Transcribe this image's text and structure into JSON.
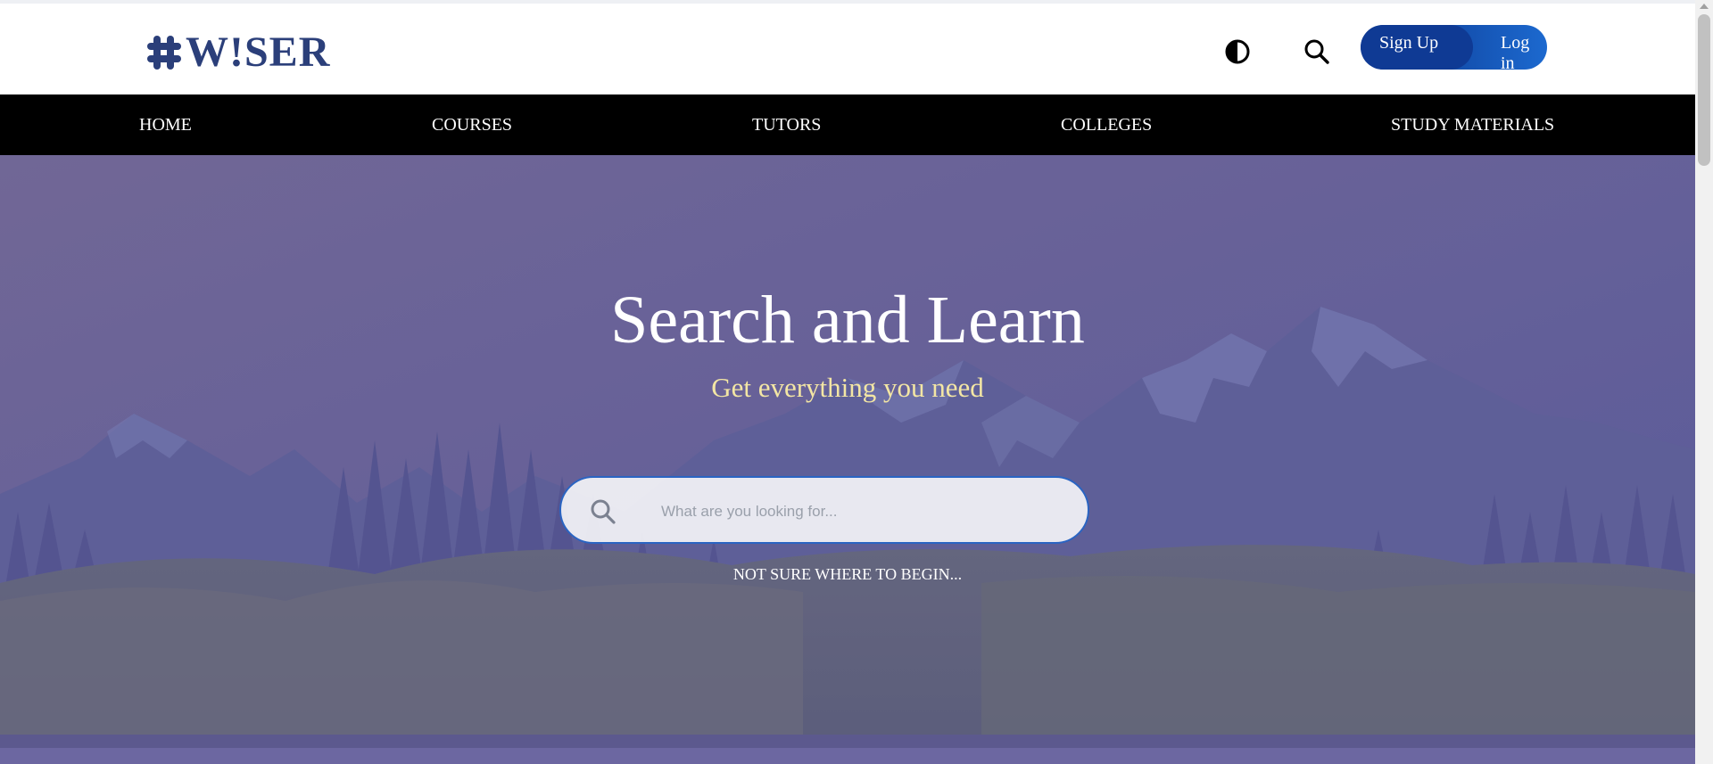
{
  "brand": {
    "logo_text": "W!SER",
    "logo_color": "#2b3f7a"
  },
  "header": {
    "icons": {
      "contrast": "contrast-icon",
      "search": "search-icon"
    },
    "auth": {
      "signup_label": "Sign Up",
      "login_label": "Log in"
    }
  },
  "nav": {
    "items": [
      {
        "label": "HOME"
      },
      {
        "label": "COURSES"
      },
      {
        "label": "TUTORS"
      },
      {
        "label": "COLLEGES"
      },
      {
        "label": "STUDY MATERIALS"
      }
    ]
  },
  "hero": {
    "title": "Search and Learn",
    "subtitle": "Get everything you need",
    "search_placeholder": "What are you looking for...",
    "hint": "NOT SURE WHERE TO BEGIN..."
  },
  "colors": {
    "accent": "#1451b0",
    "nav_bg": "#000000",
    "subtitle": "#f3e6a4",
    "hero_sky_top": "#6c6599",
    "hero_sky_bottom": "#5a5a96"
  }
}
